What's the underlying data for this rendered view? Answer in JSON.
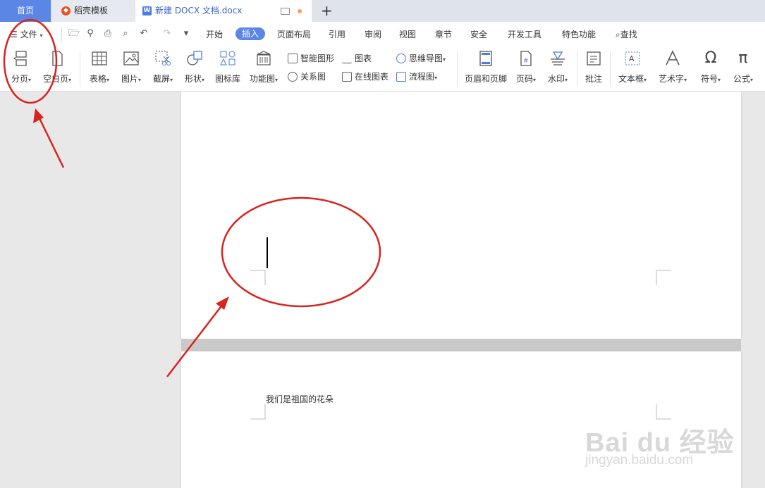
{
  "tabs": {
    "home": "首页",
    "template": "稻壳模板",
    "doc": "新建 DOCX 文档.docx",
    "new_tab": "+"
  },
  "menu": {
    "file": "文件",
    "items": [
      "开始",
      "插入",
      "页面布局",
      "引用",
      "审阅",
      "视图",
      "章节",
      "安全",
      "开发工具",
      "特色功能"
    ],
    "active": "插入",
    "search": "查找"
  },
  "ribbon": {
    "page_break": "分页",
    "blank_page": "空白页",
    "table": "表格",
    "picture": "图片",
    "screenshot": "截屏",
    "shape": "形状",
    "icon_library": "图标库",
    "function_chart": "功能图",
    "smart_art": "智能图形",
    "relation_chart": "关系图",
    "chart": "图表",
    "online_chart": "在线图表",
    "mind_map": "思维导图",
    "flowchart": "流程图",
    "header_footer": "页眉和页脚",
    "page_number": "页码",
    "watermark": "水印",
    "comment": "批注",
    "text_box": "文本框",
    "word_art": "艺术字",
    "symbol": "符号",
    "formula": "公式"
  },
  "document": {
    "page2_text": "我们是祖国的花朵"
  },
  "watermark": {
    "main": "Bai du 经验",
    "sub": "jingyan.baidu.com"
  },
  "colors": {
    "accent": "#5b86e5",
    "annotation": "#d9231d"
  }
}
